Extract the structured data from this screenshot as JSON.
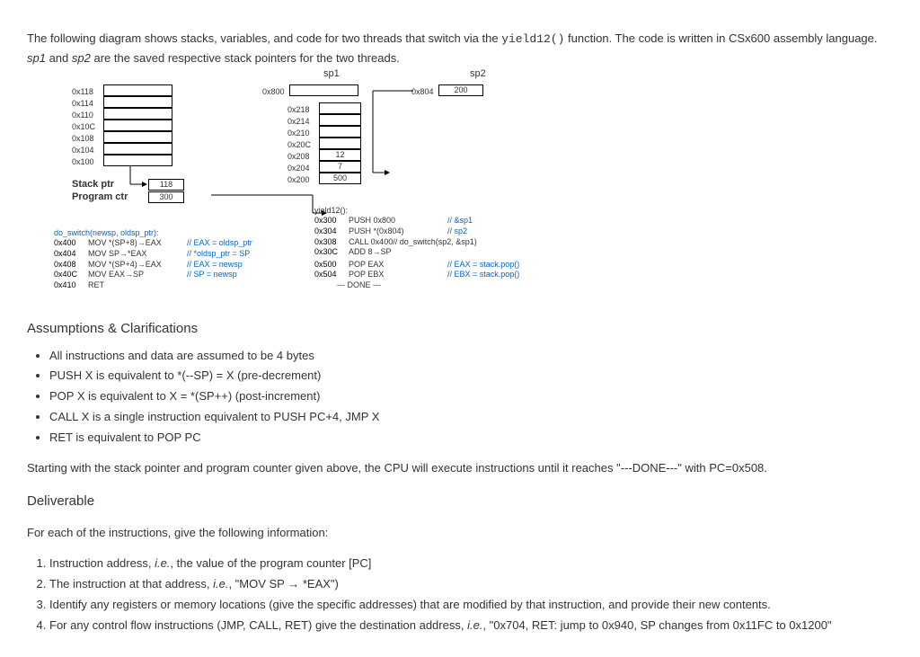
{
  "intro": {
    "p1a": "The following diagram shows stacks, variables, and code for two threads that switch via the ",
    "p1code": "yield12()",
    "p1b": " function. The code is written in CSx600 assembly language. ",
    "p1i1": "sp1",
    "p1c": " and ",
    "p1i2": "sp2",
    "p1d": " are the saved respective stack pointers for the two threads."
  },
  "diagram": {
    "sp1_label": "sp1",
    "sp2_label": "sp2",
    "sp1_addr": "0x800",
    "sp2_addr": "0x804",
    "sp2_val": "200",
    "left_addrs": [
      "0x118",
      "0x114",
      "0x110",
      "0x10C",
      "0x108",
      "0x104",
      "0x100"
    ],
    "mid_addrs": [
      "0x218",
      "0x214",
      "0x210",
      "0x20C",
      "0x208",
      "0x204",
      "0x200"
    ],
    "mid_vals": {
      "0x208": "12",
      "0x204": "7",
      "0x200": "500"
    },
    "stack_ptr_label": "Stack ptr",
    "stack_ptr_val": "118",
    "program_ctr_label": "Program ctr",
    "program_ctr_val": "300",
    "do_switch": {
      "sig": "do_switch(newsp, oldsp_ptr):",
      "rows": [
        {
          "addr": "0x400",
          "ins": "MOV *(SP+8)→EAX",
          "cm": "// EAX = oldsp_ptr"
        },
        {
          "addr": "0x404",
          "ins": "MOV SP→*EAX",
          "cm": "// *oldsp_ptr = SP"
        },
        {
          "addr": "0x408",
          "ins": "MOV *(SP+4)→EAX",
          "cm": "// EAX = newsp"
        },
        {
          "addr": "0x40C",
          "ins": "MOV EAX→SP",
          "cm": "// SP = newsp"
        },
        {
          "addr": "0x410",
          "ins": "RET",
          "cm": ""
        }
      ]
    },
    "yield12": {
      "sig": "yield12():",
      "rows": [
        {
          "addr": "0x300",
          "ins": "PUSH 0x800",
          "cm": "// &sp1"
        },
        {
          "addr": "0x304",
          "ins": "PUSH *(0x804)",
          "cm": "// sp2"
        },
        {
          "addr": "0x308",
          "ins": "CALL 0x400// do_switch(sp2, &sp1)",
          "cm": ""
        },
        {
          "addr": "0x30C",
          "ins": "ADD 8→SP",
          "cm": ""
        }
      ]
    },
    "pops": {
      "rows": [
        {
          "addr": "0x500",
          "ins": "POP EAX",
          "cm": "// EAX = stack.pop()"
        },
        {
          "addr": "0x504",
          "ins": "POP EBX",
          "cm": "// EBX = stack.pop()"
        }
      ],
      "done": "--- DONE ---"
    }
  },
  "assumptions": {
    "heading": "Assumptions & Clarifications",
    "items": [
      "All instructions and data are assumed to be 4 bytes",
      "PUSH X is equivalent to *(--SP) = X (pre-decrement)",
      "POP X is equivalent to X = *(SP++) (post-increment)",
      "CALL X is a single instruction equivalent to PUSH PC+4, JMP X",
      "RET is equivalent to POP PC"
    ]
  },
  "starting_text": "Starting with the stack pointer and program counter given above, the CPU will execute instructions until it reaches \"---DONE---\" with PC=0x508.",
  "deliverable": {
    "heading": "Deliverable",
    "intro": "For each of the instructions, give the following information:",
    "items": [
      {
        "a": "Instruction address, ",
        "i": "i.e.",
        "b": ", the value of the program counter [PC]"
      },
      {
        "a": "The instruction at that address, ",
        "i": "i.e.",
        "b": ", \"MOV SP → *EAX\")"
      },
      {
        "a": "Identify any registers or memory locations (give the specific addresses) that are modified by that instruction, and provide their new contents.",
        "i": "",
        "b": ""
      },
      {
        "a": "For any control flow instructions (JMP, CALL, RET) give the destination address, ",
        "i": "i.e.",
        "b": ", \"0x704, RET: jump to 0x940, SP changes from 0x11FC to 0x1200\""
      }
    ]
  }
}
